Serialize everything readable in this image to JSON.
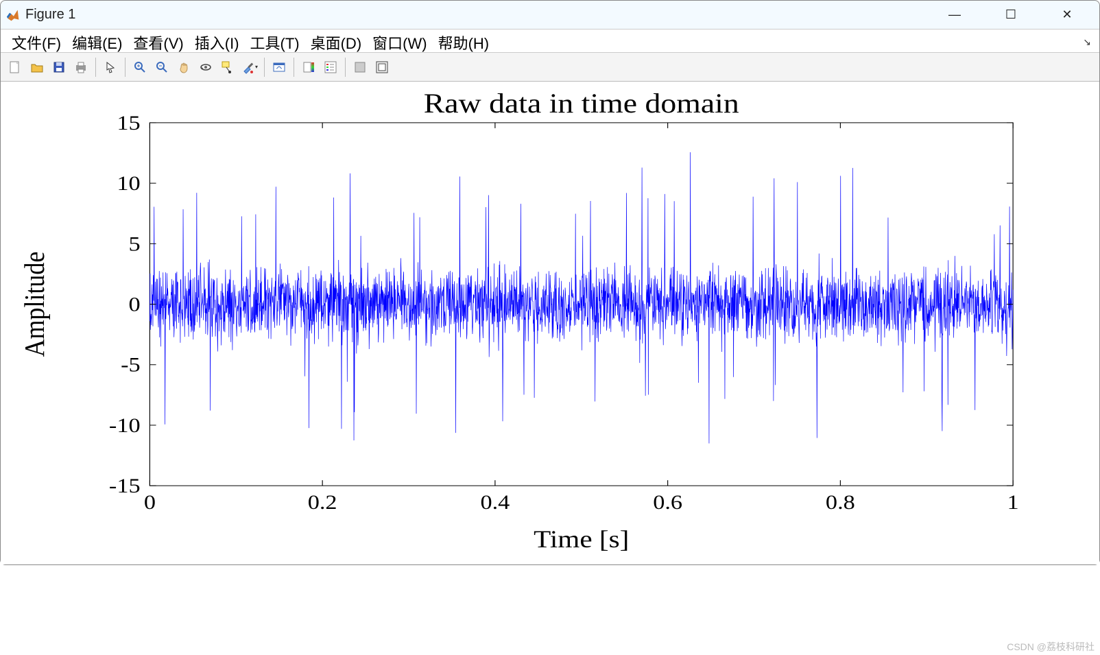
{
  "window": {
    "title": "Figure 1",
    "controls": {
      "minimize": "—",
      "maximize": "☐",
      "close": "✕"
    }
  },
  "menu": {
    "file": "文件(F)",
    "edit": "编辑(E)",
    "view": "查看(V)",
    "insert": "插入(I)",
    "tools": "工具(T)",
    "desktop": "桌面(D)",
    "window": "窗口(W)",
    "help": "帮助(H)"
  },
  "toolbar_icons": {
    "new": "new-figure-icon",
    "open": "open-icon",
    "save": "save-icon",
    "print": "print-icon",
    "pointer": "pointer-icon",
    "zoom_in": "zoom-in-icon",
    "zoom_out": "zoom-out-icon",
    "pan": "pan-icon",
    "rotate": "rotate-3d-icon",
    "datatip": "data-cursor-icon",
    "brush": "brush-icon",
    "link": "link-plot-icon",
    "colorbar": "insert-colorbar-icon",
    "legend": "insert-legend-icon",
    "hideplot": "hide-plot-tools-icon",
    "showplot": "show-plot-tools-icon"
  },
  "chart_data": {
    "type": "line",
    "title": "Raw data in time domain",
    "xlabel": "Time [s]",
    "ylabel": "Amplitude",
    "xlim": [
      0,
      1
    ],
    "ylim": [
      -15,
      15
    ],
    "xticks": [
      0,
      0.2,
      0.4,
      0.6,
      0.8,
      1
    ],
    "yticks": [
      -15,
      -10,
      -5,
      0,
      5,
      10,
      15
    ],
    "series": [
      {
        "name": "raw",
        "color": "#0000ff",
        "description": "Dense noisy signal, amplitude mostly between -5 and 5 with frequent spikes to approximately ±10 across the full 0 to 1 s range"
      }
    ]
  },
  "watermark": "CSDN @荔枝科研社"
}
